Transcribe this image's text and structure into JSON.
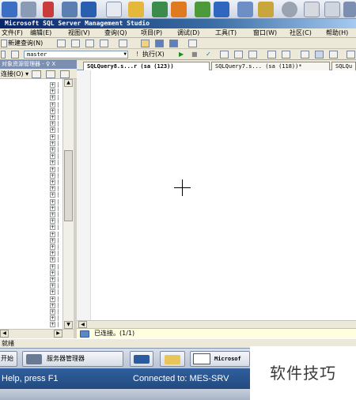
{
  "window": {
    "title": "Microsoft SQL Server Management Studio"
  },
  "menu": [
    "文件(F)",
    "编辑(E)",
    "视图(V)",
    "查询(Q)",
    "项目(P)",
    "调试(D)",
    "工具(T)",
    "窗口(W)",
    "社区(C)",
    "帮助(H)"
  ],
  "toolbar": {
    "new_query_label": "新建查询(N)",
    "execute_label": "执行(X)"
  },
  "database_selector": {
    "value": "master"
  },
  "object_explorer": {
    "title": "对象资源管理器 - ♀ X",
    "connect_label": "连接(O) ▾"
  },
  "tabs": [
    {
      "label": "SQLQuery8.s...r (sa (123))"
    },
    {
      "label": "SQLQuery7.s... (sa (118))*"
    },
    {
      "label": "SQLQu"
    }
  ],
  "editor": {
    "connection_status": "已连接。(1/1)"
  },
  "app_status": {
    "text": "就绪"
  },
  "taskbar": {
    "start_label": "开始",
    "server_manager_label": "服务器管理器",
    "ssms_label": "Microsof"
  },
  "bottom_status": {
    "help_text": "Help, press F1",
    "connected_text": "Connected to: MES-SRV"
  },
  "watermark": {
    "text": "软件技巧"
  }
}
